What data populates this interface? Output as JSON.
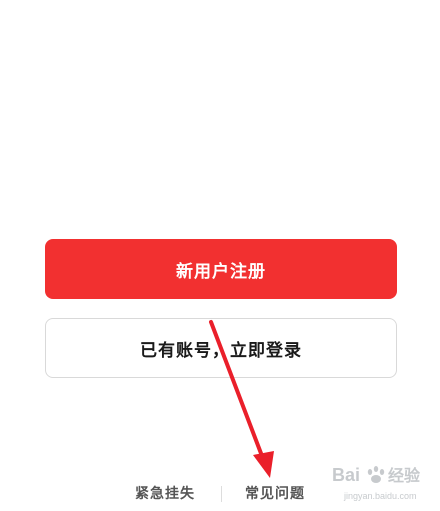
{
  "buttons": {
    "register_label": "新用户注册",
    "login_label": "已有账号，立即登录"
  },
  "footer": {
    "emergency_label": "紧急挂失",
    "faq_label": "常见问题"
  },
  "watermark": {
    "brand": "Baidu 经验",
    "url": "jingyan.baidu.com"
  },
  "colors": {
    "primary": "#f23030",
    "annotation_arrow": "#ea1f2a"
  }
}
